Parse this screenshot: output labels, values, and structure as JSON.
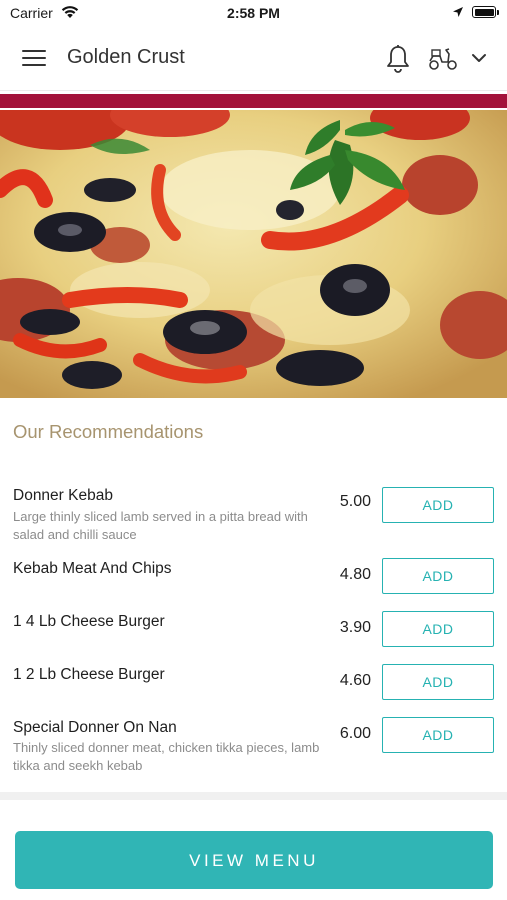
{
  "status_bar": {
    "carrier": "Carrier",
    "time": "2:58 PM"
  },
  "header": {
    "title": "Golden Crust",
    "icons": [
      "menu-icon",
      "bell-icon",
      "scooter-icon",
      "chevron-down-icon"
    ]
  },
  "colors": {
    "accent": "#30b5b5",
    "brand_bar": "#a3123a",
    "section_title": "#a7946f"
  },
  "hero": {
    "image": "pizza-photo"
  },
  "recommendations": {
    "title": "Our Recommendations",
    "add_label": "ADD",
    "items": [
      {
        "name": "Donner Kebab",
        "description": "Large thinly sliced lamb served in a pitta bread with salad and chilli sauce",
        "price": "5.00"
      },
      {
        "name": "Kebab Meat And Chips",
        "description": "",
        "price": "4.80"
      },
      {
        "name": "1 4 Lb Cheese Burger",
        "description": "",
        "price": "3.90"
      },
      {
        "name": "1 2 Lb Cheese Burger",
        "description": "",
        "price": "4.60"
      },
      {
        "name": "Special Donner On Nan",
        "description": "Thinly sliced donner meat, chicken tikka pieces, lamb tikka and seekh kebab",
        "price": "6.00"
      }
    ]
  },
  "footer": {
    "view_menu_label": "VIEW MENU"
  }
}
